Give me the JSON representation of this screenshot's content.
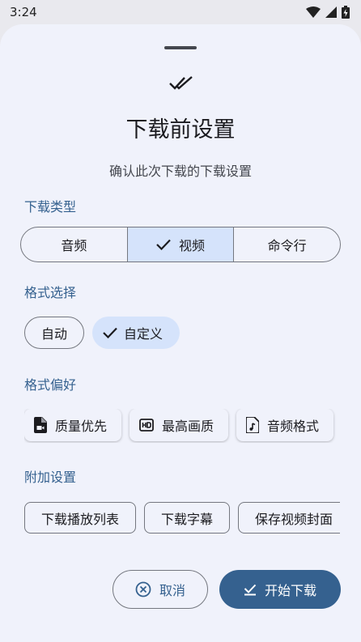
{
  "status_bar": {
    "time": "3:24",
    "icons": [
      "wifi-icon",
      "signal-icon",
      "battery-icon"
    ]
  },
  "sheet": {
    "header_icon": "done-all-icon",
    "title": "下载前设置",
    "subtitle": "确认此次下载的下载设置"
  },
  "download_type": {
    "label": "下载类型",
    "options": [
      "音频",
      "视频",
      "命令行"
    ],
    "selected": "视频"
  },
  "format_select": {
    "label": "格式选择",
    "options": [
      "自动",
      "自定义"
    ],
    "selected": "自定义"
  },
  "format_pref": {
    "label": "格式偏好",
    "items": [
      {
        "label": "质量优先",
        "icon": "video-file-icon"
      },
      {
        "label": "最高画质",
        "icon": "hd-icon"
      },
      {
        "label": "音频格式",
        "icon": "audio-file-icon"
      }
    ]
  },
  "extra": {
    "label": "附加设置",
    "items": [
      "下载播放列表",
      "下载字幕",
      "保存视频封面"
    ]
  },
  "actions": {
    "cancel": "取消",
    "start": "开始下载"
  },
  "colors": {
    "primary": "#35618f",
    "selected_bg": "#d5e3fb",
    "surface": "#f0f2fb"
  }
}
